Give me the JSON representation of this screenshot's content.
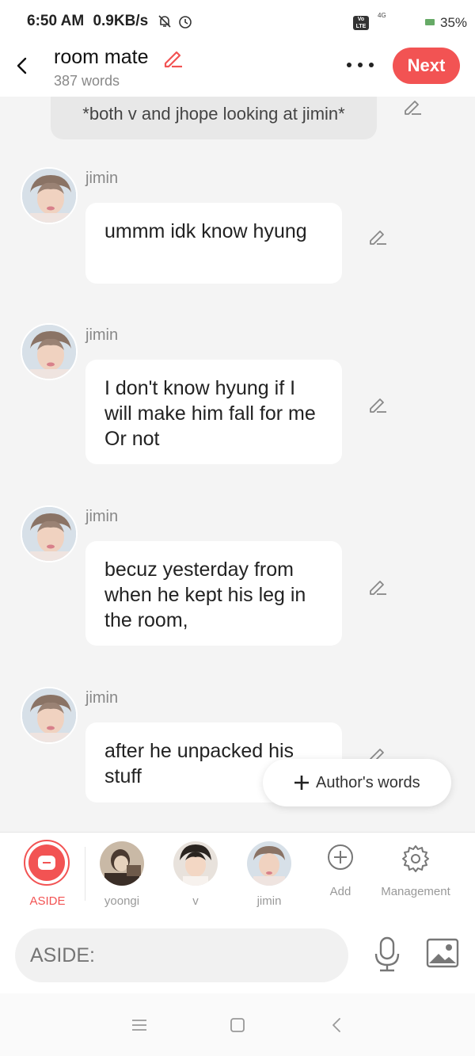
{
  "status_bar": {
    "time": "6:50 AM",
    "speed": "0.9KB/s",
    "volte": "Vo LTE",
    "network": "4G",
    "battery": "35%"
  },
  "header": {
    "title": "room mate",
    "word_count": "387 words",
    "next_label": "Next",
    "accent_color": "#f25353"
  },
  "chat": {
    "narration": "*both v and jhope looking at jimin*",
    "messages": [
      {
        "name": "jimin",
        "text": "ummm idk know hyung"
      },
      {
        "name": "jimin",
        "text": "I don't know hyung if I will make him fall for me Or not"
      },
      {
        "name": "jimin",
        "text": "becuz yesterday from when he kept his leg in the room,"
      },
      {
        "name": "jimin",
        "text": "after he unpacked his stuff"
      }
    ],
    "authors_words_label": "Author's words"
  },
  "characters": {
    "aside": "ASIDE",
    "items": [
      {
        "label": "yoongi"
      },
      {
        "label": "v"
      },
      {
        "label": "jimin"
      }
    ],
    "add_label": "Add",
    "management_label": "Management"
  },
  "input": {
    "placeholder": "ASIDE:"
  },
  "icons": {
    "back": "back-arrow-icon",
    "edit": "pencil-icon",
    "more": "more-dots-icon",
    "add": "plus-circle-icon",
    "settings": "gear-icon",
    "mic": "microphone-icon",
    "image": "image-icon"
  }
}
